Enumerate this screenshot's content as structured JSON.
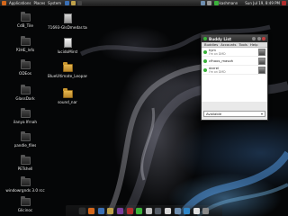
{
  "top_panel": {
    "menus": [
      "Applications",
      "Places",
      "System"
    ],
    "username": "kashmann",
    "clock": "Sun Jul 19, 8:49 PM"
  },
  "desktop_icons": [
    {
      "label": "CdB_Tile",
      "kind": "folder-dark"
    },
    {
      "label": "P3HE_lnfo",
      "kind": "folder-dark"
    },
    {
      "label": "ODEos",
      "kind": "folder-dark"
    },
    {
      "label": "GlassDark",
      "kind": "folder-dark"
    },
    {
      "label": "ilanya Ifrnah",
      "kind": "folder-dark"
    },
    {
      "label": "pandle_files",
      "kind": "folder-dark"
    },
    {
      "label": "PETshell",
      "kind": "folder-dark"
    },
    {
      "label": "windowrgnds 3.0 rcc",
      "kind": "folder-dark"
    },
    {
      "label": "Glicinoc",
      "kind": "folder-dark"
    },
    {
      "label": "71693-GlsDmedar.tar.gz",
      "kind": "archive"
    },
    {
      "label": "lucidoMirst",
      "kind": "file"
    },
    {
      "label": "BlueUltimate_Leopard_1.1.beige",
      "kind": "folder-gold"
    },
    {
      "label": "sound_nar",
      "kind": "folder-gold"
    }
  ],
  "buddy_window": {
    "title": "Buddy List",
    "menus": [
      "Buddies",
      "Accounts",
      "Tools",
      "Help"
    ],
    "buddies": [
      {
        "name": "kym",
        "status": "I'm on DMD",
        "status_color": "#3bb33b"
      },
      {
        "name": "cfhoos_masoh",
        "status": "",
        "status_color": "#3bb33b"
      },
      {
        "name": "darrel",
        "status": "I'm on DMD",
        "status_color": "#3bb33b"
      }
    ],
    "status_selector": "Available"
  },
  "dock": {
    "icons": [
      "terminal-icon",
      "browser-icon",
      "mail-icon",
      "files-icon",
      "music-icon",
      "video-icon",
      "chat-icon",
      "photos-icon",
      "settings-icon",
      "calendar-icon",
      "editor-icon",
      "download-icon",
      "network-icon",
      "trash-icon"
    ],
    "icon_colors": [
      "#2d2d2d",
      "#d4671b",
      "#3a6fb5",
      "#bfa14a",
      "#7a3e9d",
      "#b22d2d",
      "#3bb33b",
      "#c0c0c0",
      "#555c66",
      "#d9d9d9",
      "#6f8fb0",
      "#2f86c8",
      "#e0e0e0",
      "#8a8a8a"
    ]
  }
}
